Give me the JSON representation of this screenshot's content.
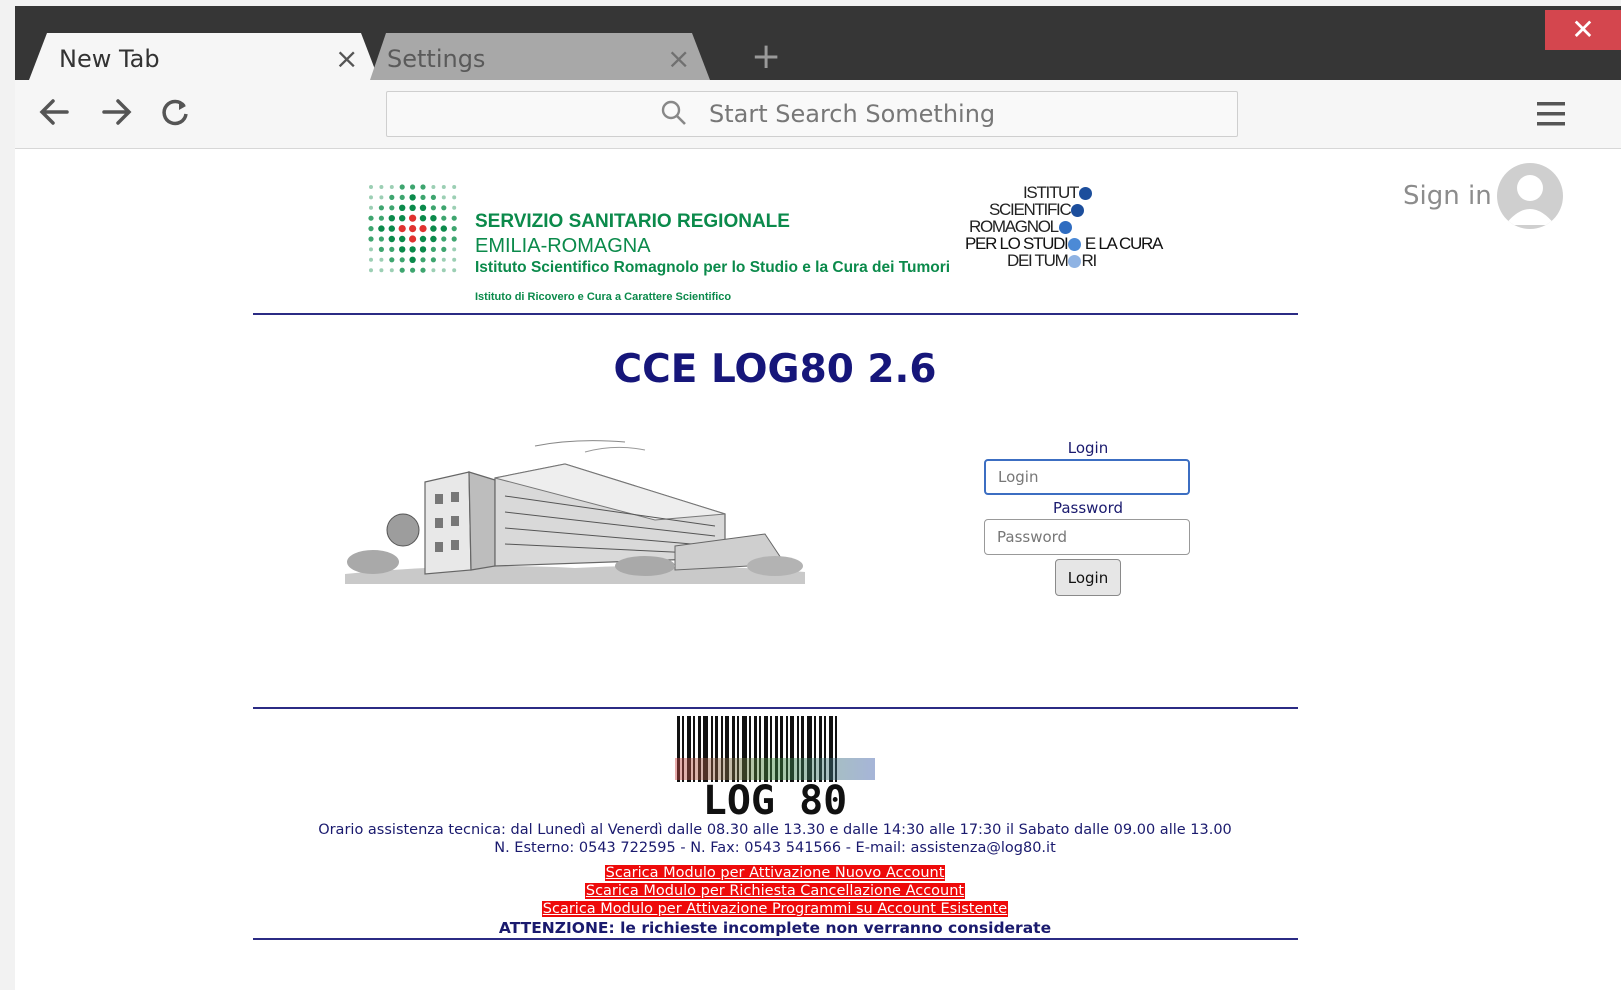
{
  "browser": {
    "tabs": [
      {
        "label": "New Tab",
        "active": true
      },
      {
        "label": "Settings",
        "active": false
      }
    ],
    "new_tab_icon": "plus-icon",
    "window_close_icon": "close-icon",
    "omnibox": {
      "placeholder": "Start Search Something"
    },
    "nav_icons": [
      "back-arrow-icon",
      "forward-arrow-icon",
      "reload-icon"
    ],
    "menu_icon": "hamburger-menu-icon",
    "sign_in_label": "Sign in"
  },
  "header": {
    "ssr_line1": "SERVIZIO SANITARIO REGIONALE",
    "ssr_line2": "EMILIA-ROMAGNA",
    "ssr_line3": "Istituto Scientifico Romagnolo per lo Studio e la Cura dei Tumori",
    "ssr_line4": "Istituto di Ricovero e Cura a Carattere Scientifico",
    "irst_line1": "ISTITUT",
    "irst_line2": "SCIENTIFIC",
    "irst_line3": "ROMAGNOL",
    "irst_line4a": "PER LO STUDI",
    "irst_line4b": " E LA CURA",
    "irst_line5a": "DEI TUM",
    "irst_line5b": "RI"
  },
  "main": {
    "title": "CCE LOG80 2.6",
    "login": {
      "login_label": "Login",
      "login_placeholder": "Login",
      "password_label": "Password",
      "password_placeholder": "Password",
      "submit_label": "Login"
    }
  },
  "footer": {
    "logo_text": "LOG 80",
    "hours": "Orario assistenza tecnica: dal Lunedì al Venerdì dalle 08.30 alle 13.30 e dalle 14:30 alle 17:30 il Sabato dalle 09.00 alle 13.00",
    "contacts": "N. Esterno: 0543 722595 - N. Fax: 0543 541566 - E-mail: assistenza@log80.it",
    "links": [
      "Scarica Modulo per Attivazione Nuovo Account",
      "Scarica Modulo per Richiesta Cancellazione Account",
      "Scarica Modulo per Attivazione Programmi su Account Esistente"
    ],
    "warning": "ATTENZIONE: le richieste incomplete non verranno considerate"
  },
  "colors": {
    "accent_navy": "#16167a",
    "ssr_green": "#0b8a4b",
    "link_red": "#ee0a0a",
    "tabstrip": "#363636"
  }
}
